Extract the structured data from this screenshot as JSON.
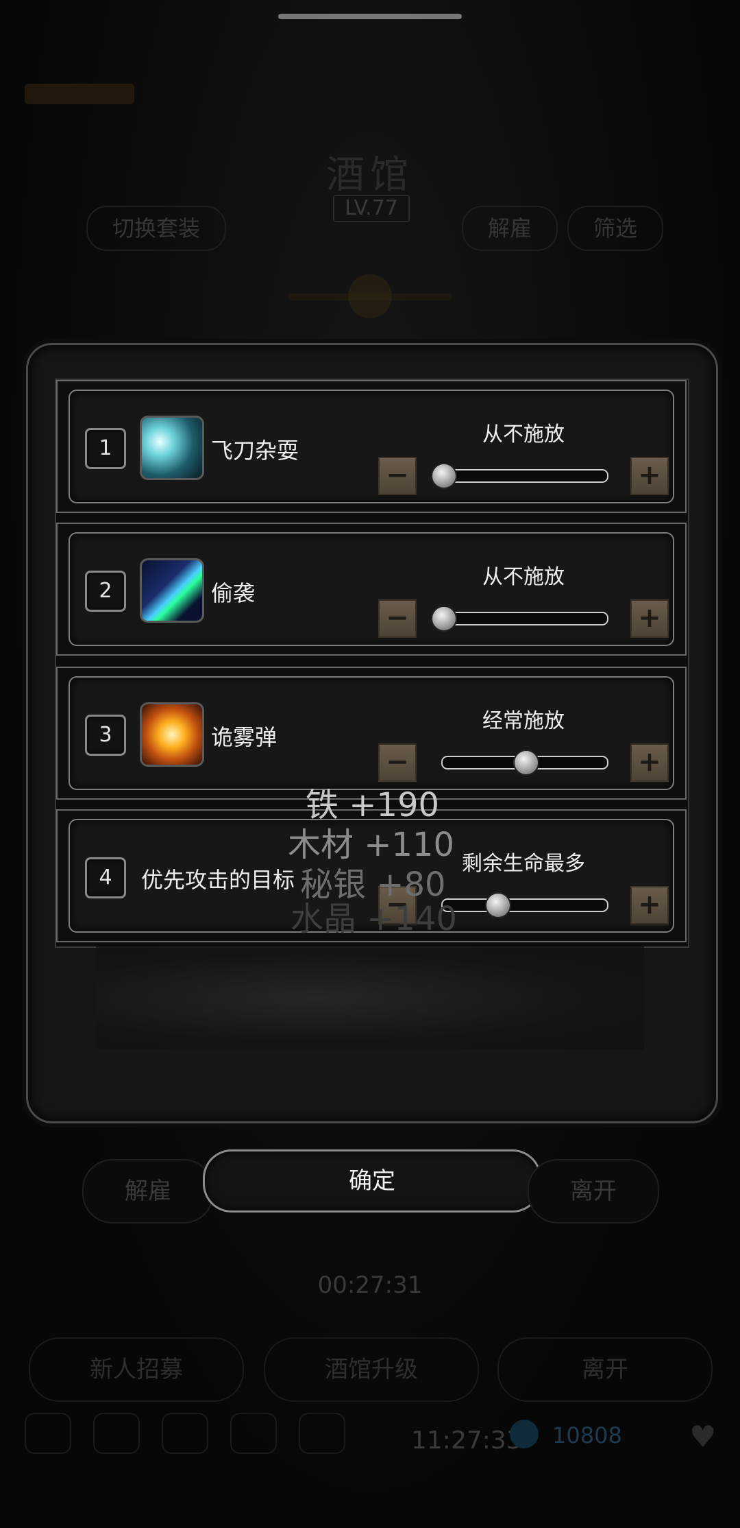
{
  "background": {
    "screen_title": "酒馆",
    "level": "LV.77",
    "switch_button": "切换套装",
    "dismiss_button": "解雇",
    "filter_button": "筛选",
    "timer": "00:27:31",
    "recruit_button": "新人招募",
    "upgrade_button": "酒馆升级",
    "leave_button": "离开",
    "clock": "11:27:33",
    "gems": "10808"
  },
  "modal": {
    "skills": [
      {
        "index": "1",
        "name": "飞刀杂耍",
        "icon": "thrown-blade-icon",
        "frequency": "从不施放",
        "level": 0.0
      },
      {
        "index": "2",
        "name": "偷袭",
        "icon": "sneak-attack-icon",
        "frequency": "从不施放",
        "level": 0.0
      },
      {
        "index": "3",
        "name": "诡雾弹",
        "icon": "fog-bomb-icon",
        "frequency": "经常施放",
        "level": 0.5
      }
    ],
    "target": {
      "index": "4",
      "label": "优先攻击的目标",
      "value": "剩余生命最多",
      "level": 0.33
    }
  },
  "resource_gain": [
    {
      "text": "铁 +190",
      "color": "#c9c9c9"
    },
    {
      "text": "木材 +110",
      "color": "#8c8c8c"
    },
    {
      "text": "秘银 +80",
      "color": "#6e6e6e"
    },
    {
      "text": "水晶 +140",
      "color": "#3e3e3e"
    }
  ],
  "footer": {
    "dismiss": "解雇",
    "confirm": "确定",
    "leave": "离开"
  }
}
